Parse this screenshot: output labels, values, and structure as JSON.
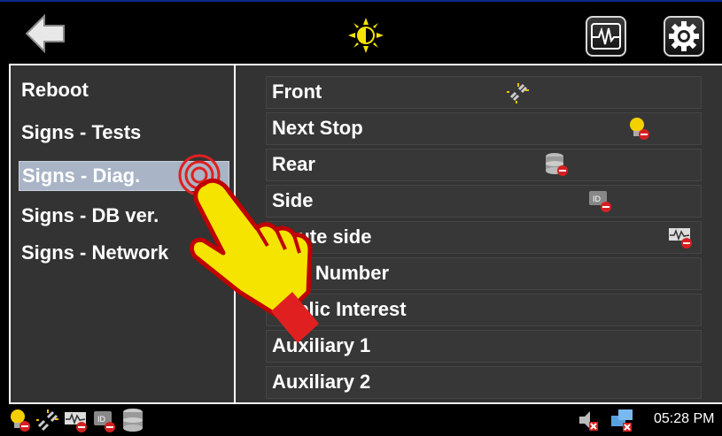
{
  "topbar": {
    "back_icon": "back-arrow-icon",
    "brightness_icon": "brightness-icon",
    "diagnostics_icon": "waveform-icon",
    "settings_icon": "gear-icon"
  },
  "menu": {
    "items": [
      {
        "label": "Reboot",
        "selected": false
      },
      {
        "label": "Signs - Tests",
        "selected": false
      },
      {
        "label": "Signs - Diag.",
        "selected": true
      },
      {
        "label": "Signs - DB ver.",
        "selected": false
      },
      {
        "label": "Signs - Network",
        "selected": false
      }
    ]
  },
  "signs": {
    "rows": [
      {
        "label": "Front",
        "icon": "link-broken-icon"
      },
      {
        "label": "Next Stop",
        "icon": "bulb-error-icon"
      },
      {
        "label": "Rear",
        "icon": "database-error-icon"
      },
      {
        "label": "Side",
        "icon": "id-error-icon"
      },
      {
        "label": "Route side",
        "icon": "signal-error-icon"
      },
      {
        "label": "Run Number",
        "icon": ""
      },
      {
        "label": "Public Interest",
        "icon": ""
      },
      {
        "label": "Auxiliary 1",
        "icon": ""
      },
      {
        "label": "Auxiliary 2",
        "icon": ""
      }
    ]
  },
  "statusbar": {
    "icons": [
      "bulb-error-icon",
      "link-broken-icon",
      "signal-error-icon",
      "id-error-icon",
      "database-icon"
    ],
    "tray_icons": [
      "speaker-muted-icon",
      "network-error-icon"
    ],
    "clock": "05:28 PM"
  },
  "colors": {
    "background": "#000000",
    "panel": "#333333",
    "selected": "#a9b4c6",
    "accent_yellow": "#f5e400",
    "error_red": "#d42020"
  }
}
